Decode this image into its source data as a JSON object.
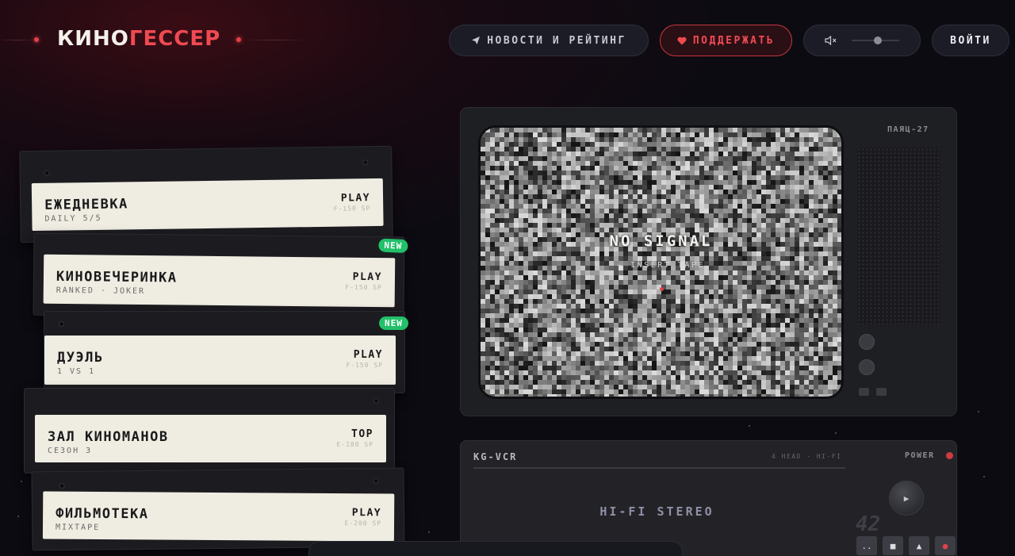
{
  "header": {
    "logo_white": "КИНО",
    "logo_red": "ГЕССЕР",
    "news_label": "НОВОСТИ И РЕЙТИНГ",
    "news_icon": "paper-plane-icon",
    "support_label": "ПОДДЕРЖАТЬ",
    "support_icon": "heart-icon",
    "volume_icon": "mute-icon",
    "volume_level": 0.5,
    "login_label": "ВОЙТИ"
  },
  "cassettes": [
    {
      "title": "ЕЖЕДНЕВКА",
      "subtitle": "DAILY 5/5",
      "action": "PLAY",
      "code": "F-150 SP",
      "badge": ""
    },
    {
      "title": "КИНОВЕЧЕРИНКА",
      "subtitle": "RANKED · JOKER",
      "action": "PLAY",
      "code": "F-150 SP",
      "badge": "NEW"
    },
    {
      "title": "ДУЭЛЬ",
      "subtitle": "1 VS 1",
      "action": "PLAY",
      "code": "F-150 SP",
      "badge": "NEW"
    },
    {
      "title": "ЗАЛ КИНОМАНОВ",
      "subtitle": "СЕЗОН 3",
      "action": "TOP",
      "code": "E-180 SP",
      "badge": ""
    },
    {
      "title": "ФИЛЬМОТЕКА",
      "subtitle": "MIXTAPE",
      "action": "PLAY",
      "code": "E-200 SP",
      "badge": ""
    }
  ],
  "tv": {
    "model": "ПАЯЦ-27",
    "no_signal": "NO SIGNAL",
    "insert_tape": "— INSERT TAPE"
  },
  "vcr": {
    "brand": "KG-VCR",
    "spec": "4 HEAD · HI-FI",
    "power": "POWER",
    "hifi": "HI-FI STEREO",
    "counter": "42",
    "buttons": [
      "..",
      "■",
      "▲",
      "●"
    ],
    "play_icon": "play-icon"
  }
}
